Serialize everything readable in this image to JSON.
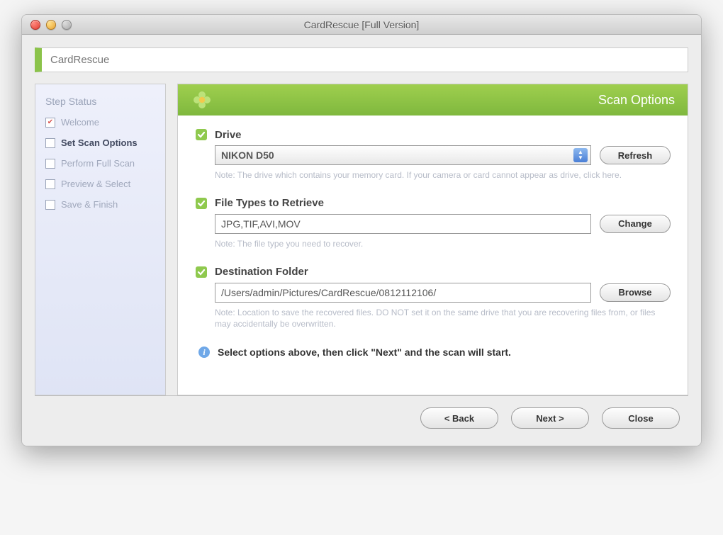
{
  "window": {
    "title": "CardRescue [Full Version]"
  },
  "appbar": {
    "name": "CardRescue"
  },
  "sidebar": {
    "title": "Step Status",
    "items": [
      {
        "label": "Welcome",
        "done": true
      },
      {
        "label": "Set Scan Options",
        "current": true
      },
      {
        "label": "Perform Full Scan"
      },
      {
        "label": "Preview & Select"
      },
      {
        "label": "Save & Finish"
      }
    ]
  },
  "panel": {
    "title": "Scan Options",
    "drive": {
      "label": "Drive",
      "value": "NIKON D50",
      "refresh": "Refresh",
      "note": "Note: The drive which contains your memory card. If your camera or card cannot appear as drive, click here."
    },
    "filetypes": {
      "label": "File Types to Retrieve",
      "value": "JPG,TIF,AVI,MOV",
      "change": "Change",
      "note": "Note: The file type you need to recover."
    },
    "destination": {
      "label": "Destination Folder",
      "value": "/Users/admin/Pictures/CardRescue/0812112106/",
      "browse": "Browse",
      "note": "Note: Location to save the recovered files. DO NOT set it on the same drive that you are recovering files from, or files may accidentally be overwritten."
    },
    "info": "Select options above, then click \"Next\" and the scan will start."
  },
  "footer": {
    "back": "< Back",
    "next": "Next >",
    "close": "Close"
  }
}
